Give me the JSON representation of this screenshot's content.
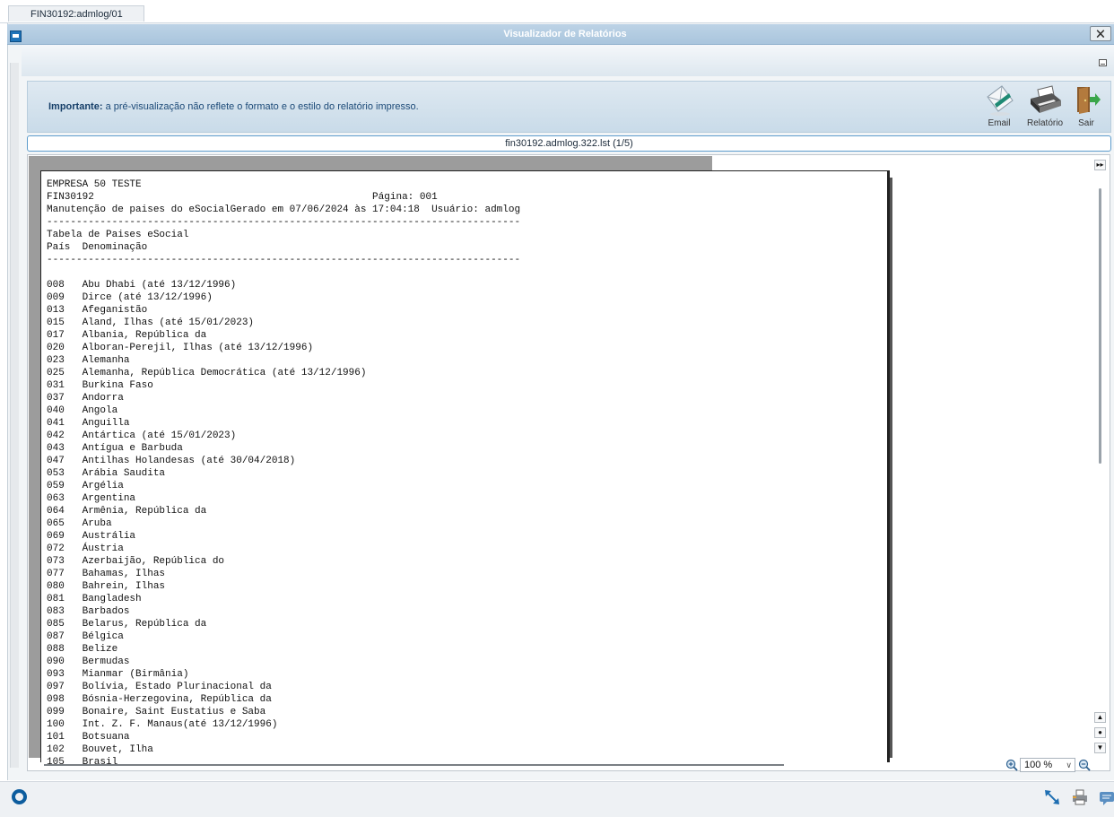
{
  "tabs": [
    {
      "label": "FIN30192:admlog/01"
    }
  ],
  "window": {
    "title": "Visualizador de Relatórios",
    "close_glyph": "🗙"
  },
  "info": {
    "label": "Importante:",
    "message": "a pré-visualização não reflete o formato e o estilo do relatório impresso."
  },
  "toolbar": {
    "email_label": "Email",
    "report_label": "Relatório",
    "exit_label": "Sair"
  },
  "file": {
    "name": "fin30192.admlog.322.lst (1/5)"
  },
  "report": {
    "lines": [
      "EMPRESA 50 TESTE",
      "FIN30192                                               Página: 001",
      "Manutenção de paises do eSocialGerado em 07/06/2024 às 17:04:18  Usuário: admlog",
      "--------------------------------------------------------------------------------",
      "Tabela de Paises eSocial",
      "País  Denominação",
      "--------------------------------------------------------------------------------",
      "",
      "008   Abu Dhabi (até 13/12/1996)",
      "009   Dirce (até 13/12/1996)",
      "013   Afeganistão",
      "015   Aland, Ilhas (até 15/01/2023)",
      "017   Albania, República da",
      "020   Alboran-Perejil, Ilhas (até 13/12/1996)",
      "023   Alemanha",
      "025   Alemanha, República Democrática (até 13/12/1996)",
      "031   Burkina Faso",
      "037   Andorra",
      "040   Angola",
      "041   Anguilla",
      "042   Antártica (até 15/01/2023)",
      "043   Antígua e Barbuda",
      "047   Antilhas Holandesas (até 30/04/2018)",
      "053   Arábia Saudita",
      "059   Argélia",
      "063   Argentina",
      "064   Armênia, República da",
      "065   Aruba",
      "069   Austrália",
      "072   Áustria",
      "073   Azerbaijão, República do",
      "077   Bahamas, Ilhas",
      "080   Bahrein, Ilhas",
      "081   Bangladesh",
      "083   Barbados",
      "085   Belarus, República da",
      "087   Bélgica",
      "088   Belize",
      "090   Bermudas",
      "093   Mianmar (Birmânia)",
      "097   Bolívia, Estado Plurinacional da",
      "098   Bósnia-Herzegovina, República da",
      "099   Bonaire, Saint Eustatius e Saba",
      "100   Int. Z. F. Manaus(até 13/12/1996)",
      "101   Botsuana",
      "102   Bouvet, Ilha",
      "105   Brasil"
    ]
  },
  "zoom": {
    "value": "100 %"
  },
  "icons": {
    "window": "window-icon",
    "close": "close-icon",
    "minimize": "minimize-icon",
    "email": "email-icon",
    "report": "printer-icon",
    "exit": "exit-door-icon",
    "zoom_in": "zoom-in-icon",
    "zoom_out": "zoom-out-icon",
    "logo": "app-logo-icon"
  },
  "colors": {
    "title_bar": "#a9c5dd",
    "info_text": "#1c4a78",
    "file_border": "#5d9ccc",
    "page_gray": "#9c9c9c"
  }
}
